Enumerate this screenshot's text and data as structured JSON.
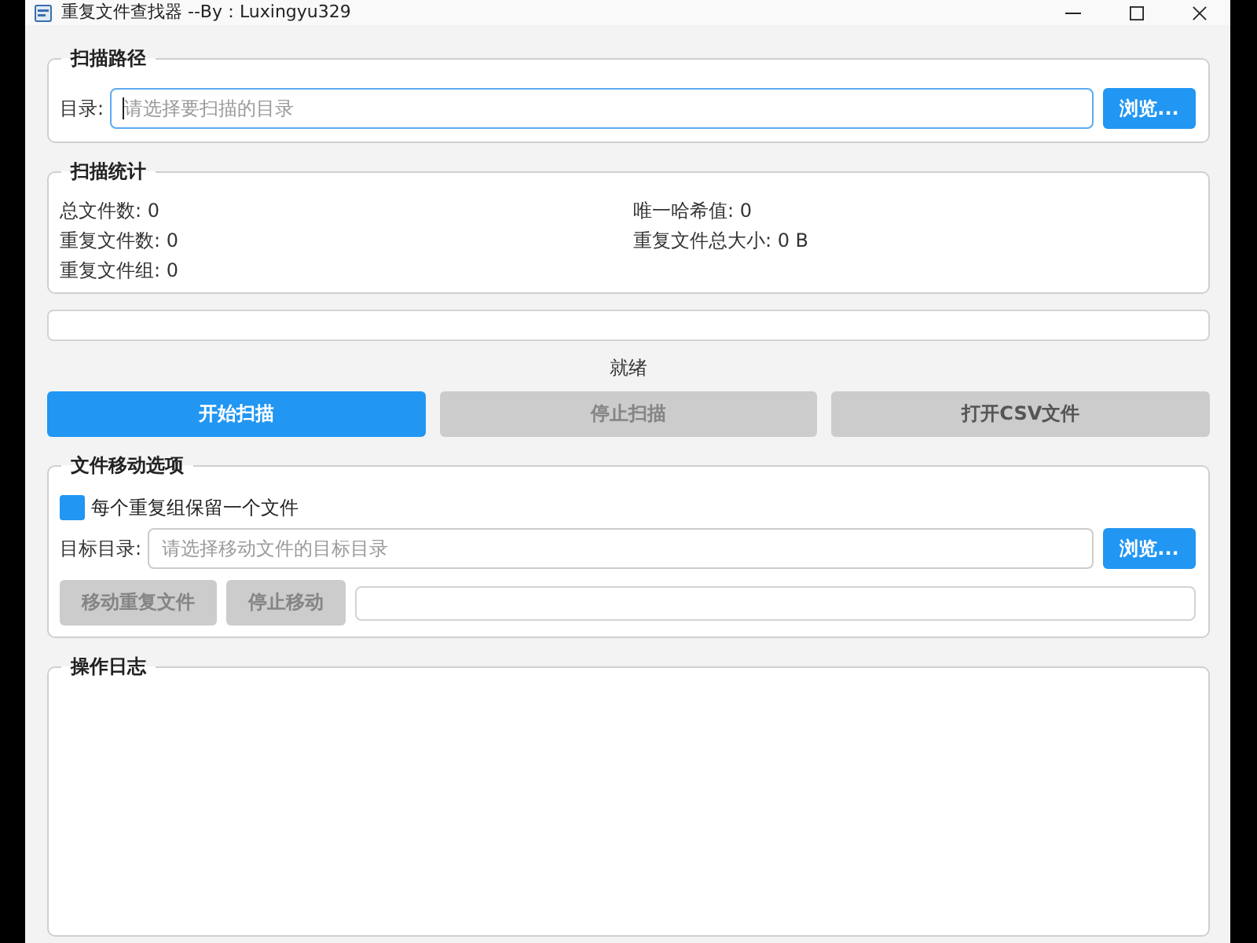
{
  "window": {
    "title": "重复文件查找器 --By：Luxingyu329"
  },
  "scan_path": {
    "title": "扫描路径",
    "label": "目录:",
    "field": {
      "placeholder": "请选择要扫描的目录",
      "focused": true
    },
    "browse_button": "浏览..."
  },
  "scan_stats": {
    "title": "扫描统计",
    "items": [
      "总文件数: 0",
      "唯一哈希值: 0",
      "重复文件数: 0",
      "重复文件总大小: 0 B",
      "重复文件组: 0"
    ]
  },
  "progress": {
    "level": 0
  },
  "status": "就绪",
  "actions": [
    {
      "label": "开始扫描",
      "kind": "primary",
      "disabled": false
    },
    {
      "label": "停止扫描",
      "kind": "secondary",
      "disabled": true
    },
    {
      "label": "打开CSV文件",
      "kind": "secondary",
      "disabled": false
    }
  ],
  "move_options": {
    "title": "文件移动选项",
    "keep_one": {
      "label": "每个重复组保留一个文件",
      "checked": true
    },
    "target_label": "目标目录:",
    "target_field": {
      "placeholder": "请选择移动文件的目标目录",
      "focused": false
    },
    "browse_button": "浏览...",
    "buttons": [
      {
        "label": "移动重复文件",
        "disabled": true
      },
      {
        "label": "停止移动",
        "disabled": true
      }
    ],
    "progress": {
      "level": 0
    }
  },
  "log": {
    "title": "操作日志"
  }
}
